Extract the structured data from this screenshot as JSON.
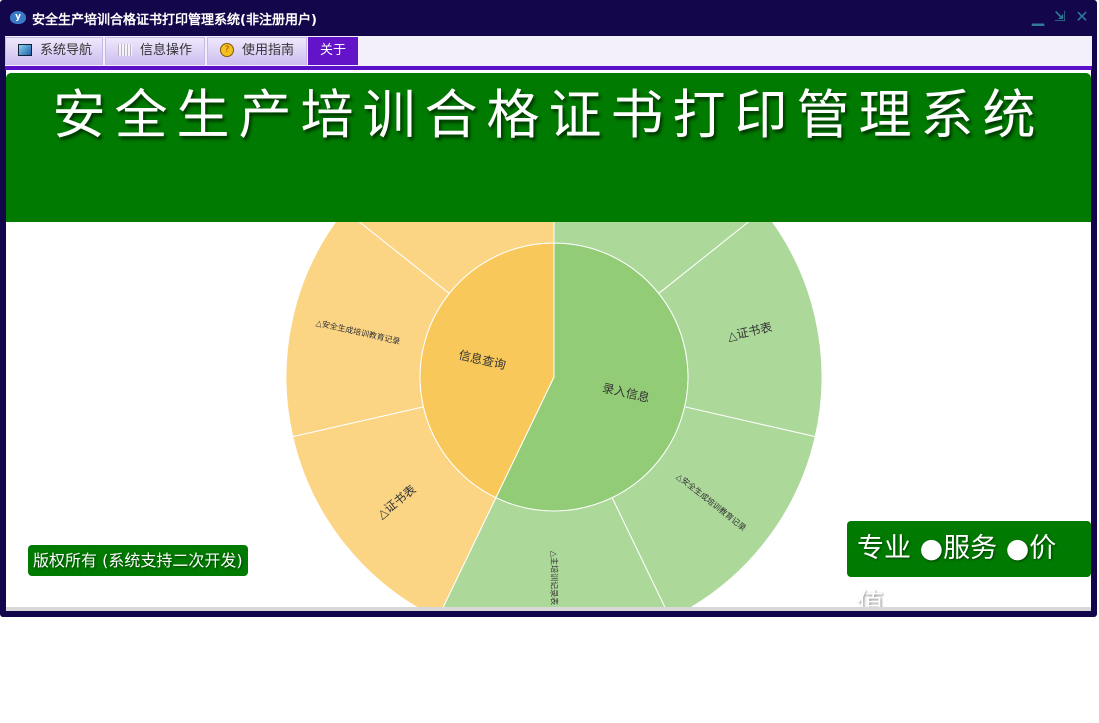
{
  "window": {
    "title": "安全生产培训合格证书打印管理系统(非注册用户)",
    "app_icon": "y-logo-icon",
    "controls": [
      "minimize-icon",
      "restore-icon",
      "close-icon"
    ]
  },
  "tabs": [
    {
      "label": "系统导航",
      "icon": "monitor-icon"
    },
    {
      "label": "信息操作",
      "icon": "grid-icon"
    },
    {
      "label": "使用指南",
      "icon": "help-icon"
    },
    {
      "label": "关于",
      "icon": ""
    }
  ],
  "header": {
    "title": "安全生产培训合格证书打印管理系统"
  },
  "footer": {
    "copyright": "版权所有 (系统支持二次开发)",
    "slogan": "专业 ●服务 ●价值"
  },
  "colors": {
    "accent": "#5a0fc8",
    "header_green": "#007a00",
    "inner_green": "#93cc76",
    "outer_green": "#acd899",
    "inner_orange": "#f9c85a",
    "outer_orange": "#fbd584"
  },
  "chart_data": {
    "type": "sunburst",
    "series": [
      {
        "name": "录入信息",
        "color": "#93cc76",
        "leafColor": "#acd899",
        "children": [
          {
            "name": "",
            "value": 1
          },
          {
            "name": "△证书表",
            "value": 1
          },
          {
            "name": "△安全生成培训教育记录",
            "value": 1
          },
          {
            "name": "△主培训记录表",
            "value": 1
          }
        ]
      },
      {
        "name": "信息查询",
        "color": "#f9c85a",
        "leafColor": "#fbd584",
        "children": [
          {
            "name": "△证书表",
            "value": 1
          },
          {
            "name": "△安全生成培训教育记录",
            "value": 1
          },
          {
            "name": "",
            "value": 1
          }
        ]
      }
    ]
  }
}
